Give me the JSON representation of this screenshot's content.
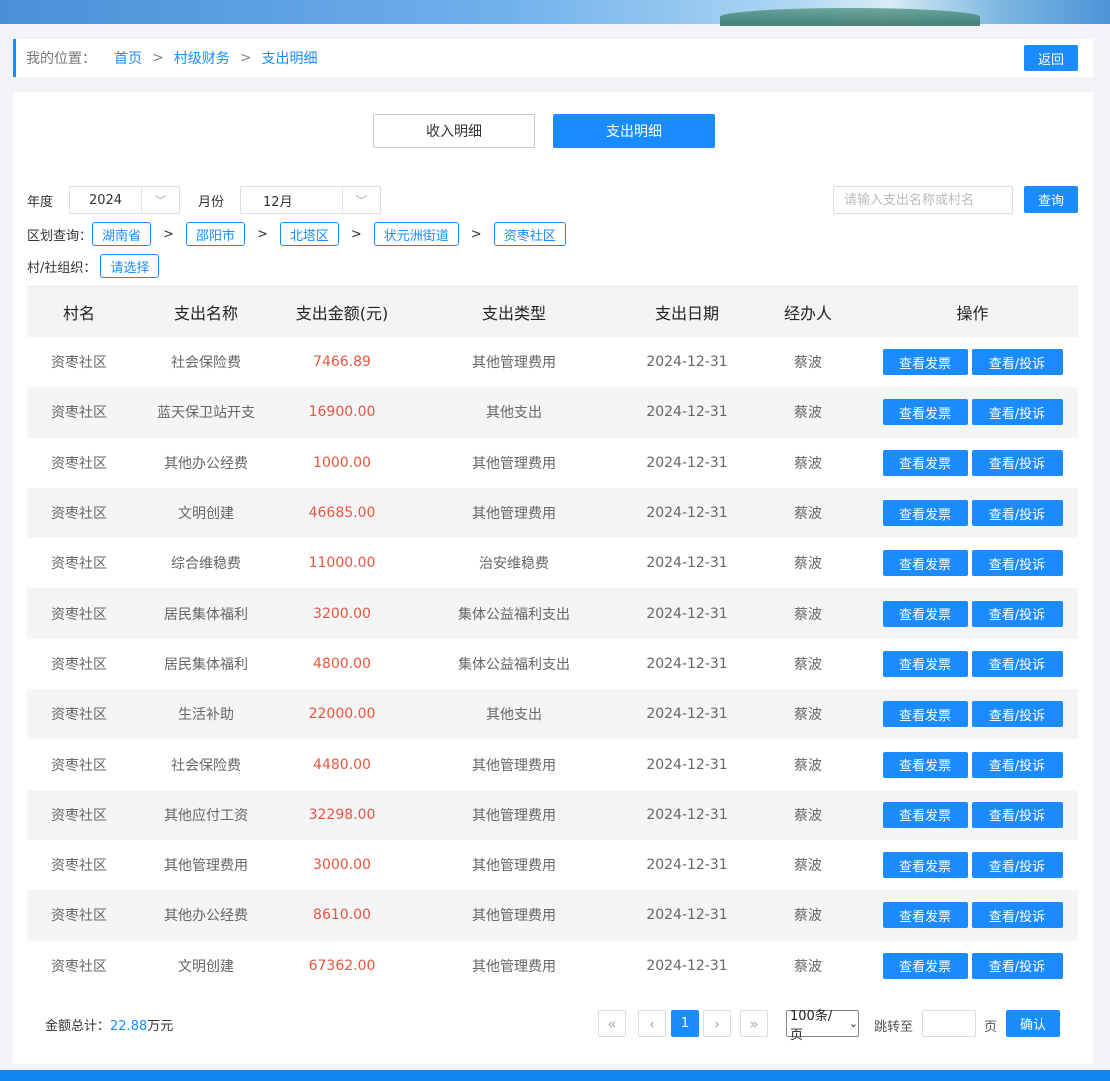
{
  "breadcrumb": {
    "label": "我的位置：",
    "items": [
      "首页",
      "村级财务",
      "支出明细"
    ],
    "separator": ">",
    "back_label": "返回"
  },
  "tabs": {
    "income_label": "收入明细",
    "expense_label": "支出明细",
    "active": "expense"
  },
  "filters": {
    "year_label": "年度",
    "year_value": "2024",
    "month_label": "月份",
    "month_value": "12月",
    "search_placeholder": "请输入支出名称或村名",
    "query_label": "查询",
    "region_label": "区划查询：",
    "regions": [
      "湖南省",
      "邵阳市",
      "北塔区",
      "状元洲街道",
      "资枣社区"
    ],
    "org_label": "村/社组织：",
    "org_value": "请选择"
  },
  "table": {
    "headers": [
      "村名",
      "支出名称",
      "支出金额(元)",
      "支出类型",
      "支出日期",
      "经办人",
      "操作"
    ],
    "action_invoice": "查看发票",
    "action_complain": "查看/投诉",
    "rows": [
      {
        "village": "资枣社区",
        "name": "社会保险费",
        "amount": "7466.89",
        "type": "其他管理费用",
        "date": "2024-12-31",
        "handler": "蔡波"
      },
      {
        "village": "资枣社区",
        "name": "蓝天保卫站开支",
        "amount": "16900.00",
        "type": "其他支出",
        "date": "2024-12-31",
        "handler": "蔡波"
      },
      {
        "village": "资枣社区",
        "name": "其他办公经费",
        "amount": "1000.00",
        "type": "其他管理费用",
        "date": "2024-12-31",
        "handler": "蔡波"
      },
      {
        "village": "资枣社区",
        "name": "文明创建",
        "amount": "46685.00",
        "type": "其他管理费用",
        "date": "2024-12-31",
        "handler": "蔡波"
      },
      {
        "village": "资枣社区",
        "name": "综合维稳费",
        "amount": "11000.00",
        "type": "治安维稳费",
        "date": "2024-12-31",
        "handler": "蔡波"
      },
      {
        "village": "资枣社区",
        "name": "居民集体福利",
        "amount": "3200.00",
        "type": "集体公益福利支出",
        "date": "2024-12-31",
        "handler": "蔡波"
      },
      {
        "village": "资枣社区",
        "name": "居民集体福利",
        "amount": "4800.00",
        "type": "集体公益福利支出",
        "date": "2024-12-31",
        "handler": "蔡波"
      },
      {
        "village": "资枣社区",
        "name": "生活补助",
        "amount": "22000.00",
        "type": "其他支出",
        "date": "2024-12-31",
        "handler": "蔡波"
      },
      {
        "village": "资枣社区",
        "name": "社会保险费",
        "amount": "4480.00",
        "type": "其他管理费用",
        "date": "2024-12-31",
        "handler": "蔡波"
      },
      {
        "village": "资枣社区",
        "name": "其他应付工资",
        "amount": "32298.00",
        "type": "其他管理费用",
        "date": "2024-12-31",
        "handler": "蔡波"
      },
      {
        "village": "资枣社区",
        "name": "其他管理费用",
        "amount": "3000.00",
        "type": "其他管理费用",
        "date": "2024-12-31",
        "handler": "蔡波"
      },
      {
        "village": "资枣社区",
        "name": "其他办公经费",
        "amount": "8610.00",
        "type": "其他管理费用",
        "date": "2024-12-31",
        "handler": "蔡波"
      },
      {
        "village": "资枣社区",
        "name": "文明创建",
        "amount": "67362.00",
        "type": "其他管理费用",
        "date": "2024-12-31",
        "handler": "蔡波"
      }
    ]
  },
  "footer": {
    "total_label": "金额总计：",
    "total_value": "22.88",
    "total_unit": "万元",
    "current_page": "1",
    "page_size": "100条/页",
    "jump_label": "跳转至",
    "page_unit": "页",
    "confirm_label": "确认"
  },
  "colors": {
    "accent": "#1a8cff",
    "amount": "#e8553e"
  }
}
